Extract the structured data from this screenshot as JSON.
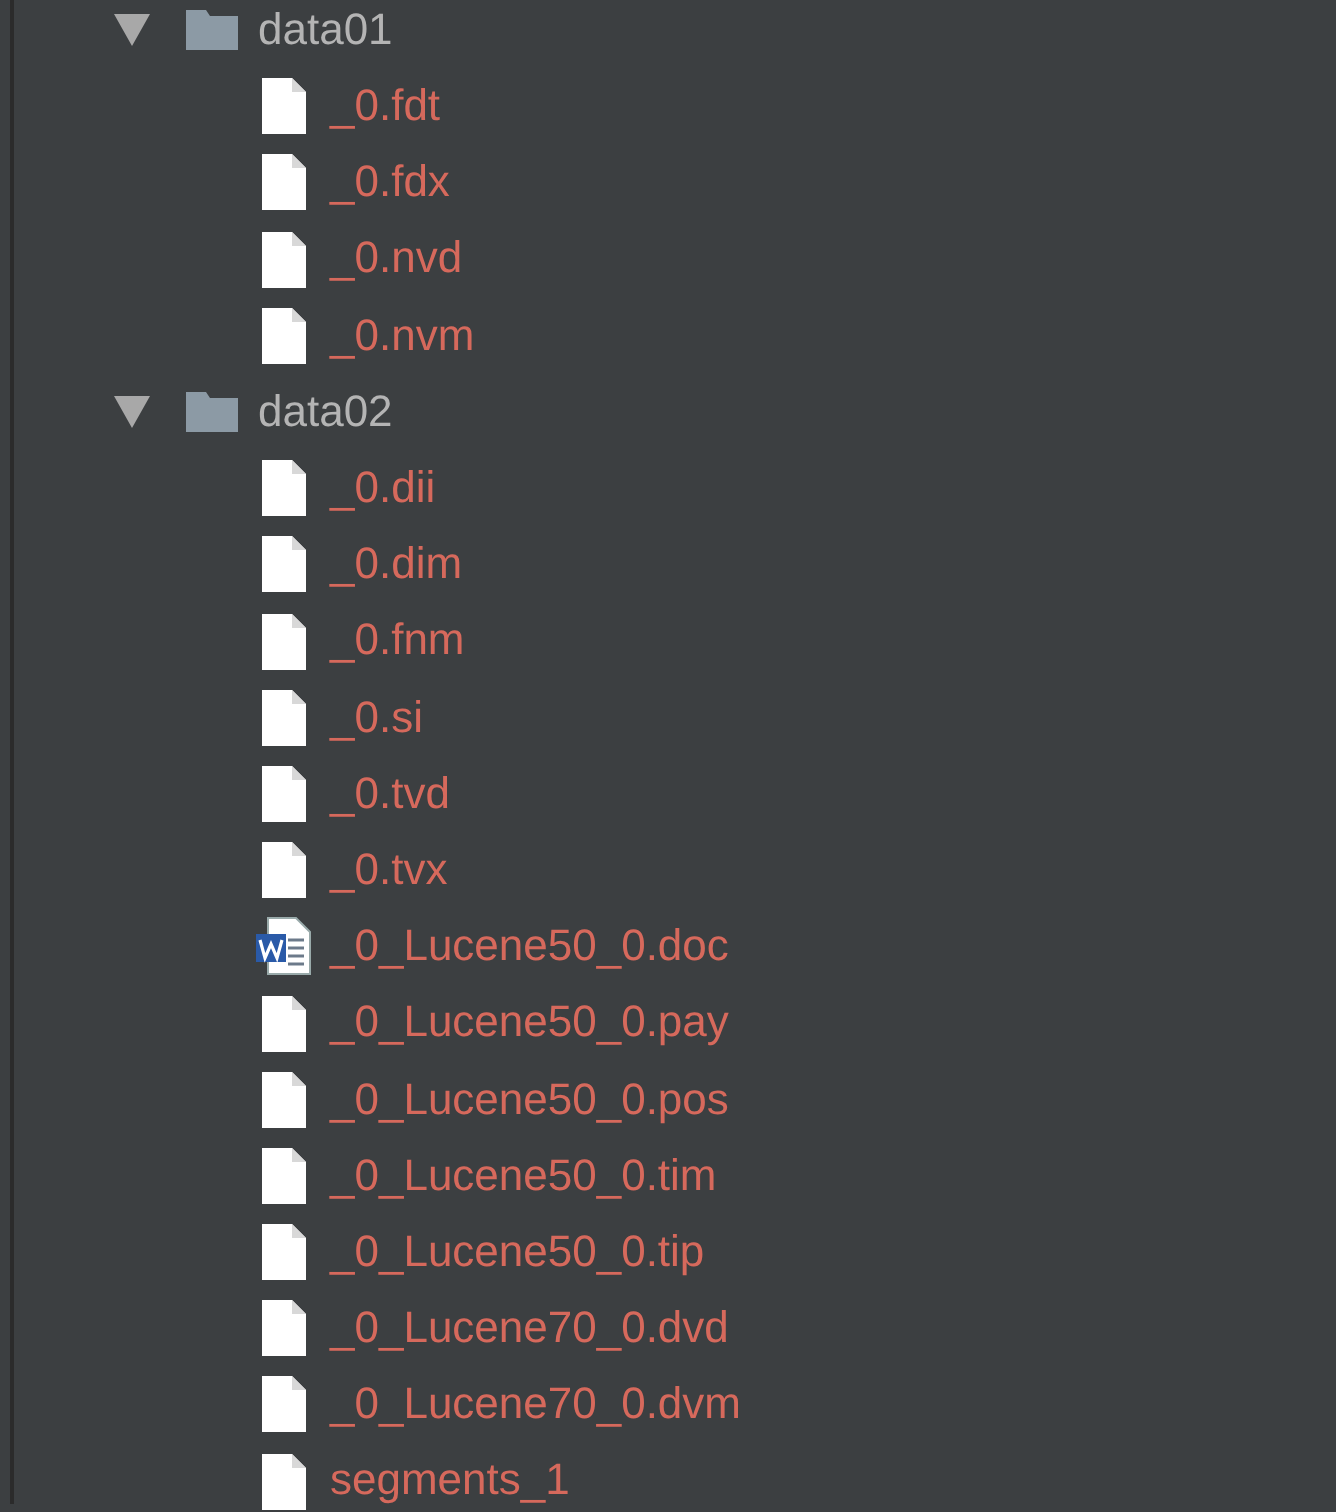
{
  "tree": [
    {
      "kind": "folder",
      "label": "data01",
      "expanded": true,
      "children": [
        {
          "kind": "file",
          "label": "_0.fdt"
        },
        {
          "kind": "file",
          "label": "_0.fdx"
        },
        {
          "kind": "file",
          "label": "_0.nvd"
        },
        {
          "kind": "file",
          "label": "_0.nvm"
        }
      ]
    },
    {
      "kind": "folder",
      "label": "data02",
      "expanded": true,
      "children": [
        {
          "kind": "file",
          "label": "_0.dii"
        },
        {
          "kind": "file",
          "label": "_0.dim"
        },
        {
          "kind": "file",
          "label": "_0.fnm"
        },
        {
          "kind": "file",
          "label": "_0.si"
        },
        {
          "kind": "file",
          "label": "_0.tvd"
        },
        {
          "kind": "file",
          "label": "_0.tvx"
        },
        {
          "kind": "word",
          "label": "_0_Lucene50_0.doc"
        },
        {
          "kind": "file",
          "label": "_0_Lucene50_0.pay"
        },
        {
          "kind": "file",
          "label": "_0_Lucene50_0.pos"
        },
        {
          "kind": "file",
          "label": "_0_Lucene50_0.tim"
        },
        {
          "kind": "file",
          "label": "_0_Lucene50_0.tip"
        },
        {
          "kind": "file",
          "label": "_0_Lucene70_0.dvd"
        },
        {
          "kind": "file",
          "label": "_0_Lucene70_0.dvm"
        },
        {
          "kind": "file",
          "label": "segments_1"
        }
      ]
    }
  ]
}
